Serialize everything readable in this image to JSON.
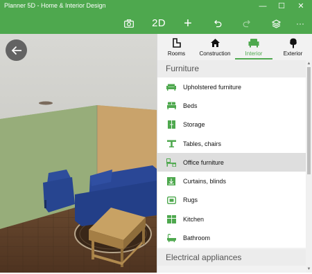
{
  "window": {
    "title": "Planner 5D - Home & Interior Design",
    "minimize_glyph": "—",
    "maximize_glyph": "☐",
    "close_glyph": "✕"
  },
  "toolbar": {
    "view_mode_label": "2D",
    "add_glyph": "+",
    "more_glyph": "···",
    "icons": [
      "camera-icon",
      "plus-icon",
      "undo-icon",
      "redo-icon",
      "layers-icon",
      "more-icon"
    ]
  },
  "scene": {
    "back_icon": "arrow-left-icon"
  },
  "tabs": [
    {
      "label": "Rooms",
      "icon": "rooms-icon",
      "active": false
    },
    {
      "label": "Construction",
      "icon": "house-icon",
      "active": false
    },
    {
      "label": "Interior",
      "icon": "armchair-icon",
      "active": true
    },
    {
      "label": "Exterior",
      "icon": "tree-icon",
      "active": false
    }
  ],
  "catalog": {
    "section_title": "Furniture",
    "items": [
      {
        "label": "Upholstered furniture",
        "icon": "sofa-icon",
        "selected": false
      },
      {
        "label": "Beds",
        "icon": "bed-icon",
        "selected": false
      },
      {
        "label": "Storage",
        "icon": "cabinet-icon",
        "selected": false
      },
      {
        "label": "Tables, chairs",
        "icon": "table-icon",
        "selected": false
      },
      {
        "label": "Office furniture",
        "icon": "desk-icon",
        "selected": true
      },
      {
        "label": "Curtains, blinds",
        "icon": "curtain-icon",
        "selected": false
      },
      {
        "label": "Rugs",
        "icon": "rug-icon",
        "selected": false
      },
      {
        "label": "Kitchen",
        "icon": "kitchen-icon",
        "selected": false
      },
      {
        "label": "Bathroom",
        "icon": "bathtub-icon",
        "selected": false
      }
    ],
    "next_section_title": "Electrical appliances"
  },
  "colors": {
    "accent": "#4ea84e",
    "panel_bg": "#f2f2f2",
    "selected_row": "#dedede"
  }
}
